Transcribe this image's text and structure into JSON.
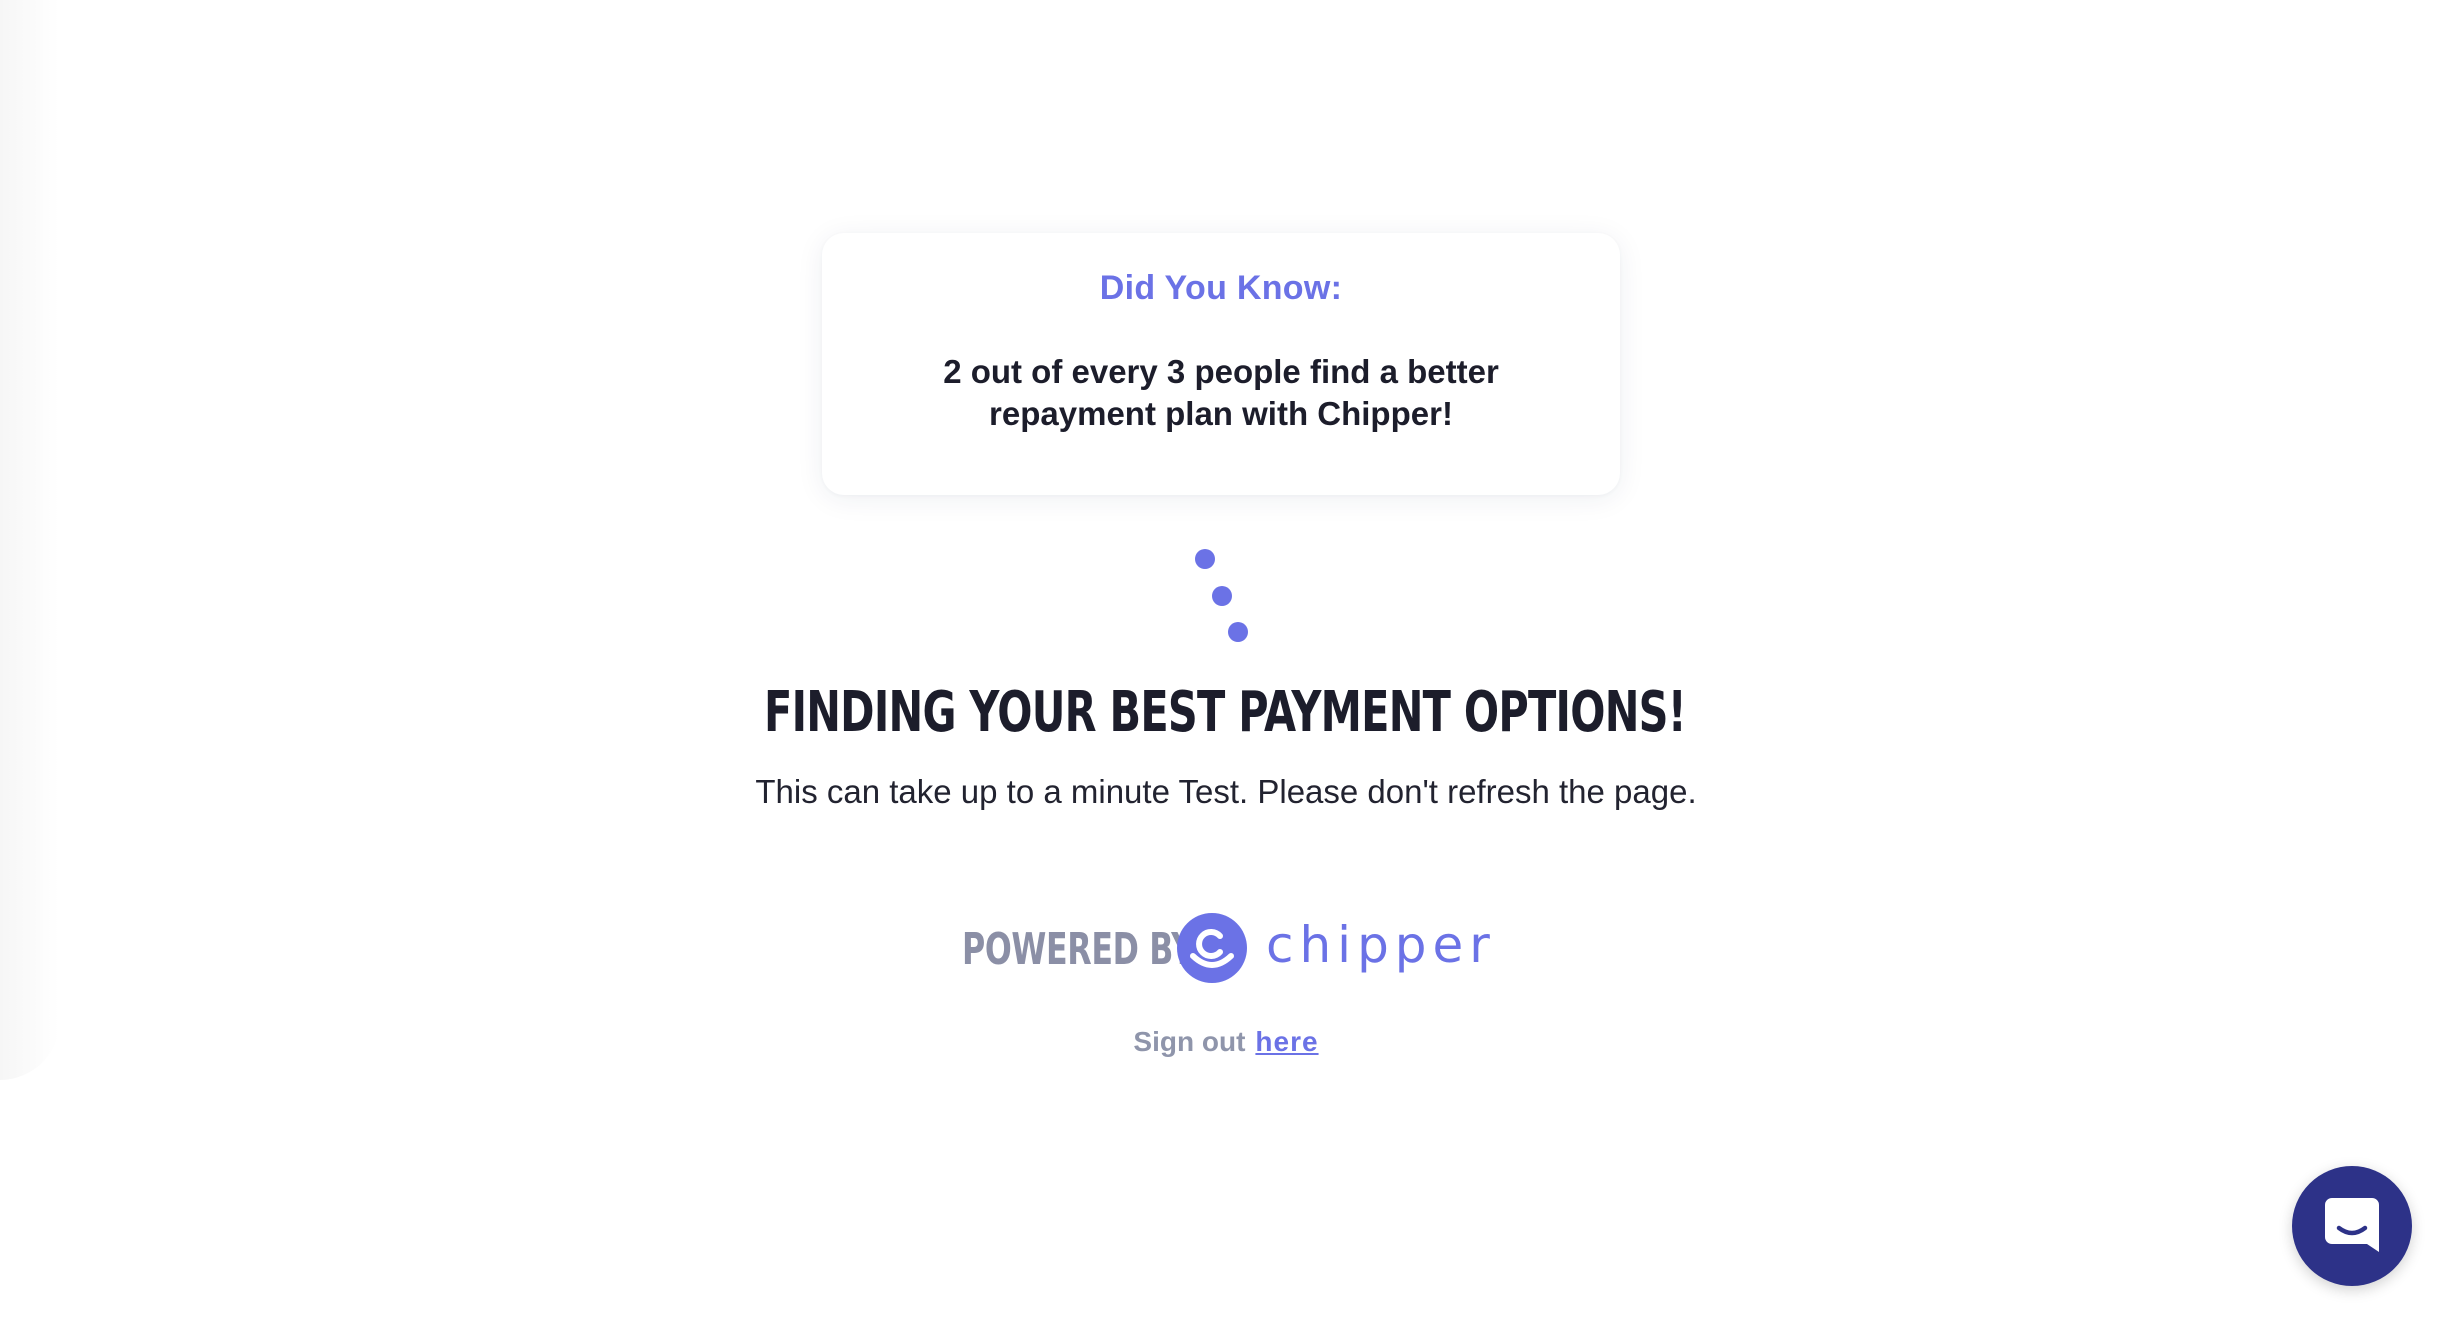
{
  "tip": {
    "title": "Did You Know:",
    "body": "2 out of every 3 people find a better repayment plan with Chipper!"
  },
  "loading": {
    "headline": "FINDING YOUR BEST PAYMENT OPTIONS!",
    "subtext": "This can take up to a minute Test. Please don't refresh the page."
  },
  "branding": {
    "powered_by": "POWERED BY",
    "wordmark": "chipper",
    "accent_color": "#6b72e6"
  },
  "signout": {
    "prefix": "Sign out",
    "link_label": "here"
  },
  "chat": {
    "icon": "chat-bubble-icon",
    "color": "#2d3288"
  }
}
